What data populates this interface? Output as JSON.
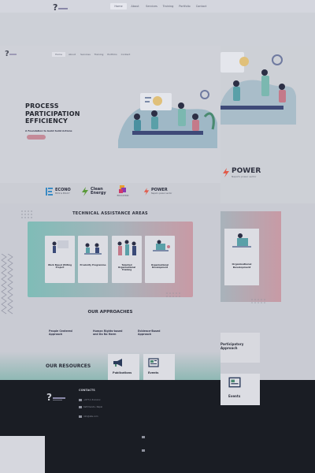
{
  "top_nav": {
    "items": [
      "Home",
      "About",
      "Services",
      "Training",
      "Portfolio",
      "Contact"
    ],
    "active_index": 0
  },
  "secondary_nav": {
    "items": [
      "Home",
      "About",
      "Services",
      "Training",
      "Portfolio",
      "Contact"
    ],
    "active_index": 0
  },
  "hero": {
    "title_lines": [
      "PROCESS",
      "PARTICIPATION",
      "EFFICIENCY"
    ],
    "subtitle": "A Foundation to build Solid Actions",
    "button_label": ""
  },
  "partners": [
    {
      "name": "ECONO",
      "sub": "MICS & POLICY",
      "icon": "ie-logo-icon"
    },
    {
      "name": "Clean",
      "sub": "Energy",
      "icon": "lightning-leaf-icon"
    },
    {
      "name": "",
      "sub": "EDUCATION",
      "icon": "education-logo-icon"
    },
    {
      "name": "POWER",
      "sub": "Nepal's power sector",
      "icon": "power-logo-icon"
    }
  ],
  "power_side": {
    "name": "POWER",
    "sub": "Nepal's power sector"
  },
  "technical": {
    "title": "TECHNICAL ASSISTANCE AREAS",
    "cards": [
      {
        "title": "Work Based Writing Project",
        "desc": "",
        "link": ""
      },
      {
        "title": "Proximity Programme",
        "desc": "",
        "link": ""
      },
      {
        "title": "Talented Organisational Training",
        "desc": "",
        "link": ""
      },
      {
        "title": "Organisational Development",
        "desc": "",
        "link": ""
      }
    ],
    "side_card_title": "Organisational Development"
  },
  "approaches": {
    "title": "OUR APPROACHES",
    "items": [
      "People Centered Approach",
      "Human Rights-based and Do No Harm",
      "Evidence-Based Approach"
    ],
    "side_label": "Participatory Approach"
  },
  "resources": {
    "title": "OUR RESOURCES",
    "cards": [
      {
        "label": "Publications",
        "icon": "megaphone-icon"
      },
      {
        "label": "Events",
        "icon": "newspaper-icon"
      }
    ],
    "side_label": "Events"
  },
  "footer": {
    "contacts_title": "CONTACTS",
    "items": [
      "+977-1-5xxxxxx",
      "Kathmandu, Nepal",
      "info@site.com"
    ],
    "copyright": "",
    "extra_items": [
      "",
      ""
    ]
  },
  "colors": {
    "hero_accent": "#c48a98",
    "panel_left": "#7fbcb7",
    "panel_right": "#c89aa5",
    "footer_bg": "#1a1d24"
  }
}
